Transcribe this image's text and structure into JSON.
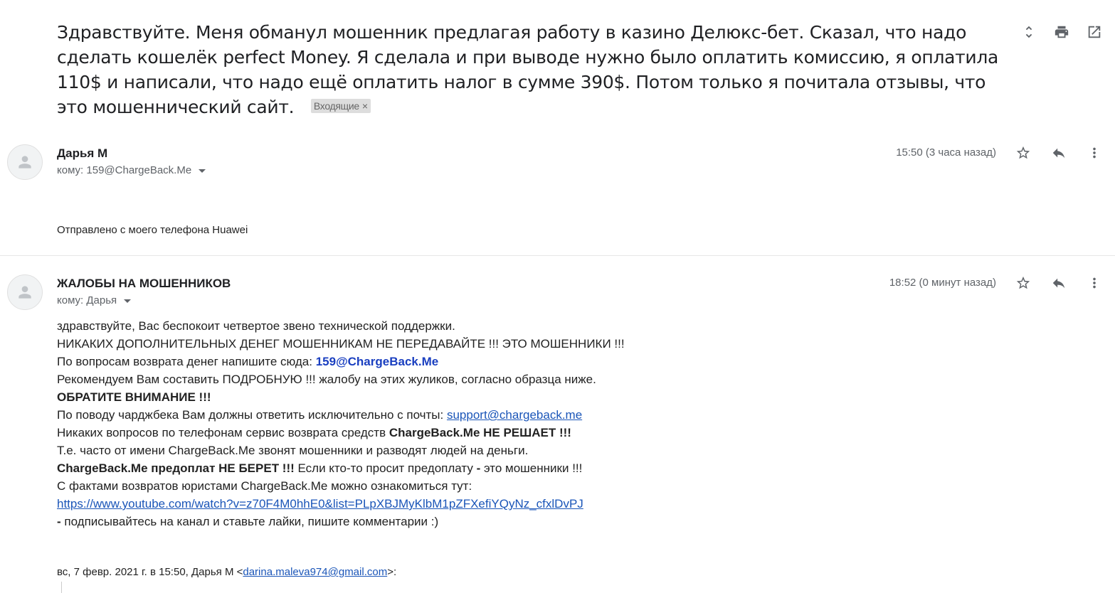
{
  "subject": {
    "text": "Здравствуйте. Меня обманул мошенник предлагая работу в казино Делюкс-бет. Сказал, что надо сделать кошелёк perfect Money. Я сделала и при выводе нужно было оплатить комиссию, я оплатила 110$ и написали, что надо ещё оплатить налог в сумме 390$. Потом только я почитала отзывы, что это мошеннический сайт.",
    "label": "Входящие",
    "label_close": "×"
  },
  "top_actions": [
    "expand-collapse-icon",
    "print-icon",
    "open-new-window-icon"
  ],
  "messages": [
    {
      "sender": "Дарья М",
      "to": "кому: 159@ChargeBack.Me",
      "time": "15:50 (3 часа назад)",
      "body": "Отправлено с моего телефона Huawei"
    },
    {
      "sender": "ЖАЛОБЫ НА МОШЕННИКОВ",
      "to": "кому: Дарья",
      "time": "18:52 (0 минут назад)",
      "lines": {
        "l1": "здравствуйте, Вас беспокоит четвертое звено технической поддержки.",
        "l2": "НИКАКИХ ДОПОЛНИТЕЛЬНЫХ ДЕНЕГ МОШЕННИКАМ НЕ ПЕРЕДАВАЙТЕ !!! ЭТО МОШЕННИКИ !!!",
        "l3_prefix": "По вопросам возврата денег напишите сюда: ",
        "l3_email": "159@ChargeBack.Me",
        "l4": "Рекомендуем Вам составить ПОДРОБНУЮ !!! жалобу на этих жуликов, согласно образца ниже.",
        "l5": "ОБРАТИТЕ ВНИМАНИЕ !!!",
        "l6_prefix": "По поводу чарджбека Вам должны ответить исключительно с почты: ",
        "l6_email": "support@chargeback.me",
        "l7_prefix": "Никаких вопросов по телефонам сервис возврата средств ",
        "l7_bold": "ChargeBack.Me НЕ РЕШАЕТ !!!",
        "l8": "Т.е. часто от имени ChargeBack.Me звонят мошенники и разводят людей на деньги.",
        "l9_bold": "ChargeBack.Me предоплат НЕ БЕРЕТ !!!",
        "l9_mid": " Если кто-то просит предоплату ",
        "l9_dash": "-",
        "l9_end": " это мошенники !!!",
        "l10": "С фактами возвратов юристами ChargeBack.Me можно ознакомиться тут:",
        "l11_link": "https://www.youtube.com/watch?v=z70F4M0hhE0&list=PLpXBJMyKlbM1pZFXefiYQyNz_cfxlDvPJ",
        "l12_dash": " -",
        "l12": " подписывайтесь на канал и ставьте лайки, пишите комментарии :)"
      },
      "quote": {
        "prefix": "вс, 7 февр. 2021 г. в 15:50, Дарья М <",
        "email": "darina.maleva974@gmail.com",
        "suffix": ">:"
      }
    }
  ]
}
